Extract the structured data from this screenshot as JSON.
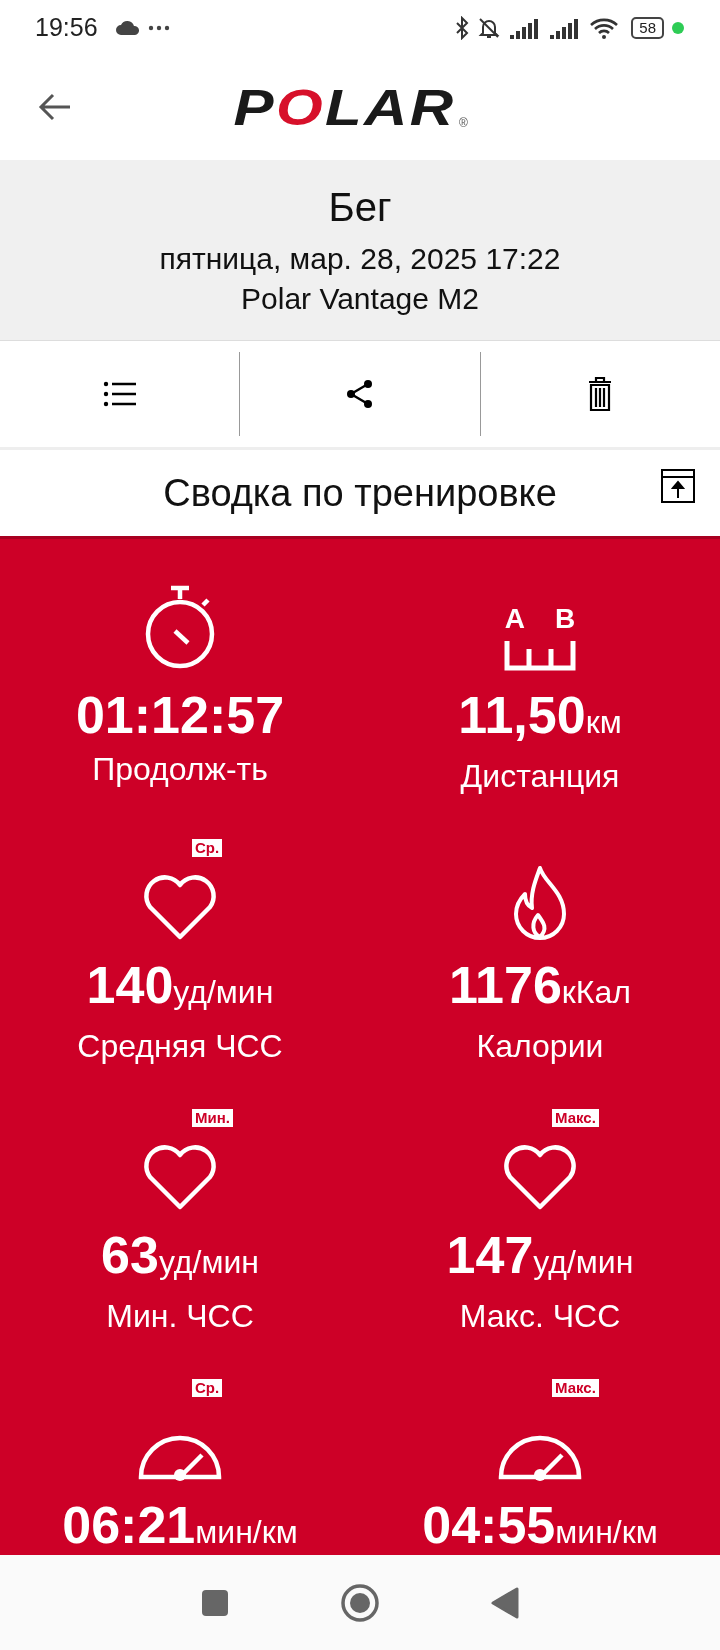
{
  "status_bar": {
    "time": "19:56",
    "battery": "58"
  },
  "app_bar": {
    "logo": "POLAR",
    "logo_mark": "®"
  },
  "header": {
    "title": "Бег",
    "date": "пятница, мар. 28, 2025 17:22",
    "device": "Polar Vantage M2"
  },
  "toolbar": [
    {
      "kind": "list"
    },
    {
      "kind": "share"
    },
    {
      "kind": "delete"
    }
  ],
  "summary": {
    "title": "Сводка по тренировке"
  },
  "distance_icon": {
    "letters": [
      "A",
      "B"
    ]
  },
  "metrics": [
    {
      "kind": "stopwatch",
      "value": "01:12:57",
      "label": "Продолж-ть"
    },
    {
      "kind": "distance",
      "value": "11,50",
      "unit": "км",
      "label": "Дистанция"
    },
    {
      "kind": "heart",
      "badge": "Ср.",
      "value": "140",
      "unit": "уд/мин",
      "label": "Средняя ЧСС"
    },
    {
      "kind": "flame",
      "value": "1176",
      "unit": "кКал",
      "label": "Калории"
    },
    {
      "kind": "heart",
      "badge": "Мин.",
      "value": "63",
      "unit": "уд/мин",
      "label": "Мин. ЧСС"
    },
    {
      "kind": "heart",
      "badge": "Макс.",
      "value": "147",
      "unit": "уд/мин",
      "label": "Макс. ЧСС"
    },
    {
      "kind": "gauge",
      "badge": "Ср.",
      "value": "06:21",
      "unit": "мин/км"
    },
    {
      "kind": "gauge",
      "badge": "Макс.",
      "value": "04:55",
      "unit": "мин/км"
    }
  ]
}
